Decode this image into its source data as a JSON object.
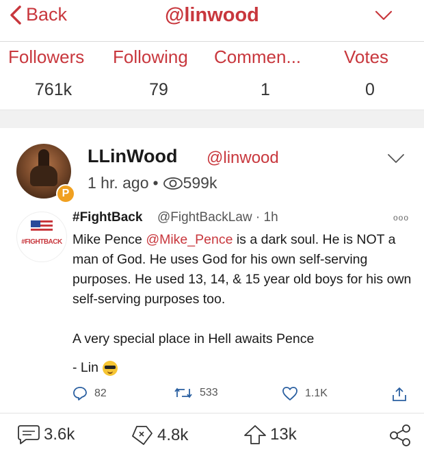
{
  "header": {
    "back_label": "Back",
    "title": "@linwood"
  },
  "stats": [
    {
      "label": "Followers",
      "value": "761k"
    },
    {
      "label": "Following",
      "value": "79"
    },
    {
      "label": "Commen...",
      "value": "1"
    },
    {
      "label": "Votes",
      "value": "0"
    }
  ],
  "post": {
    "author_name": "LLinWood",
    "author_handle": "@linwood",
    "time": "1 hr. ago",
    "dot": "•",
    "views": "599k",
    "avatar_badge": "P"
  },
  "embedded_tweet": {
    "avatar_tag": "#FIGHTBACK",
    "name": "#FightBack",
    "handle_time": "@FightBackLaw · 1h",
    "more": "ooo",
    "text_before_mention": "Mike Pence ",
    "mention": "@Mike_Pence",
    "text_after_mention": " is a dark soul. He is NOT a man of God. He uses God for his own self-serving purposes. He used 13, 14, & 15 year old boys for his own self-serving purposes too.",
    "paragraph2": "A very special place in Hell awaits Pence",
    "signature": "- Lin",
    "replies": "82",
    "retweets": "533",
    "likes": "1.1K"
  },
  "post_actions": {
    "comments": "3.6k",
    "echoes": "4.8k",
    "upvotes": "13k"
  },
  "colors": {
    "accent": "#c8373d",
    "badge": "#f0a020"
  }
}
